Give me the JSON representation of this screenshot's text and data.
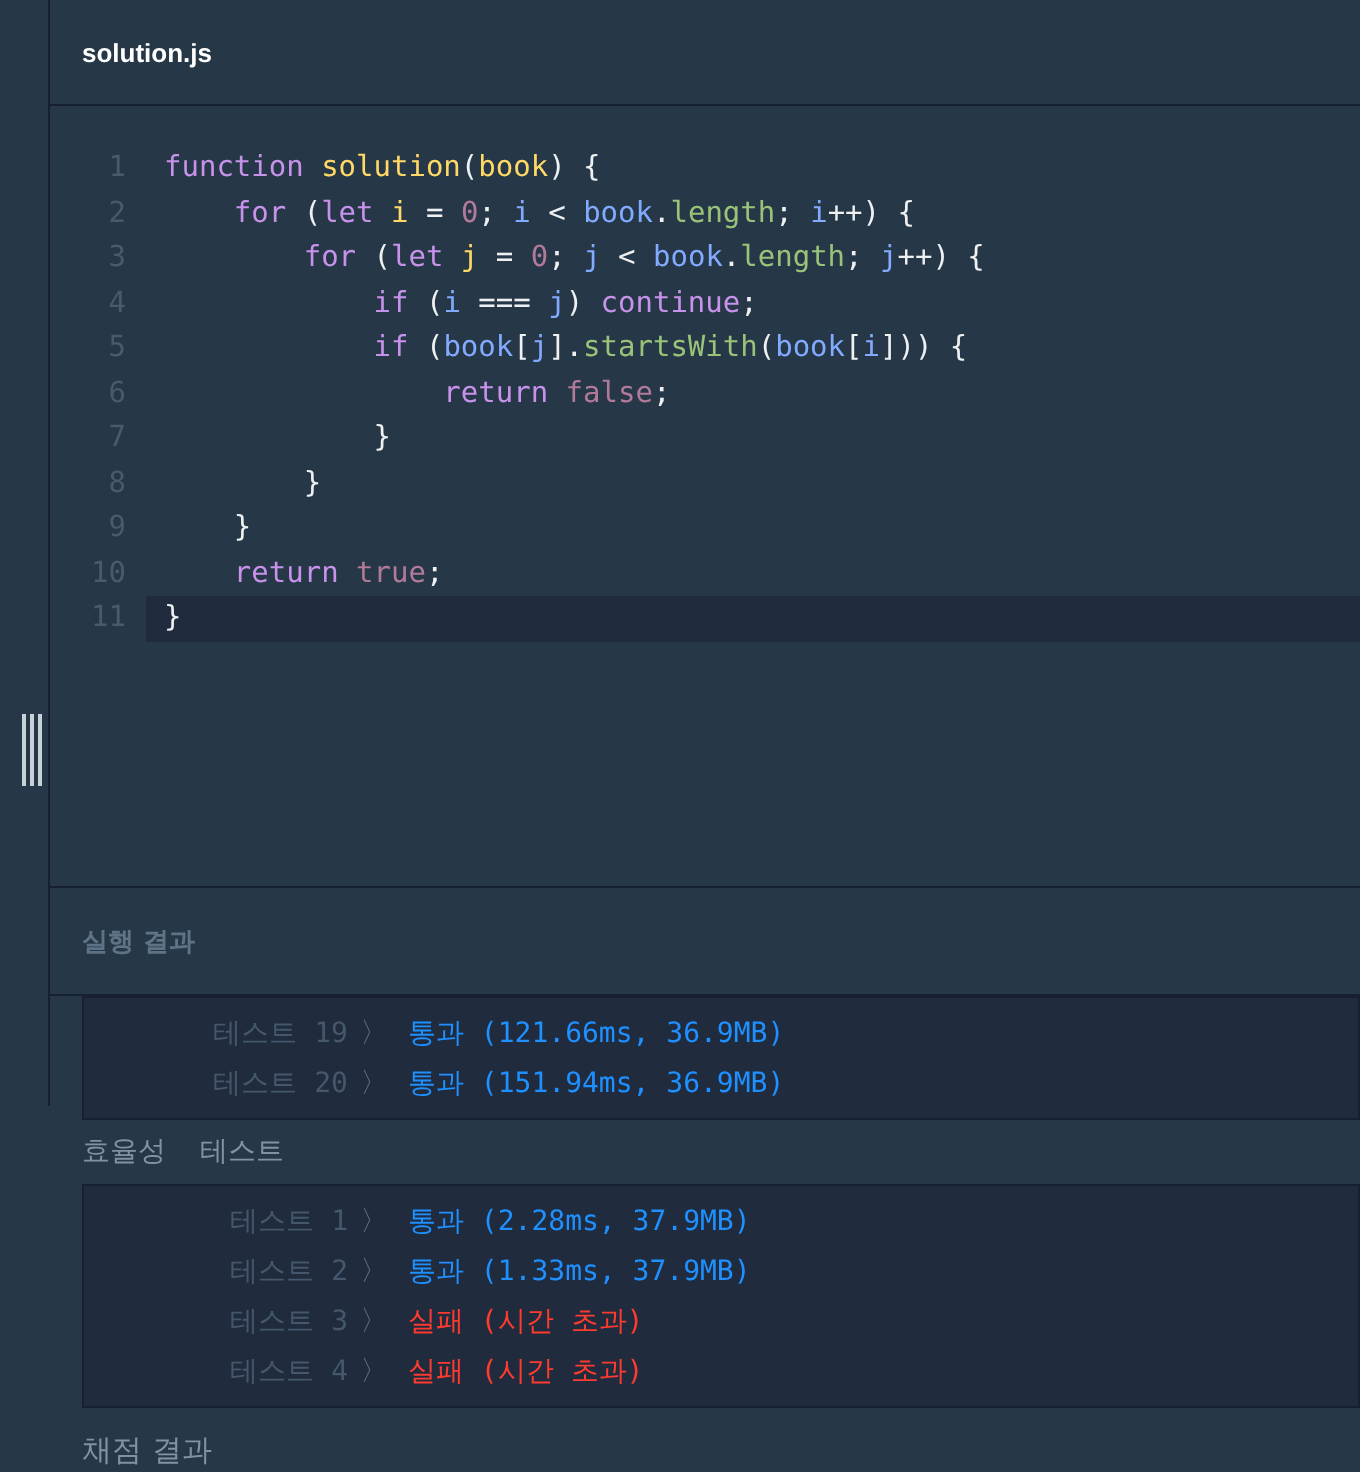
{
  "editor": {
    "filename": "solution.js",
    "lines": [
      {
        "number": "1",
        "active": false,
        "tokens": [
          {
            "t": "function ",
            "kind": "keyword"
          },
          {
            "t": "solution",
            "kind": "name"
          },
          {
            "t": "(",
            "kind": "plain"
          },
          {
            "t": "book",
            "kind": "name"
          },
          {
            "t": ") {",
            "kind": "plain"
          }
        ]
      },
      {
        "number": "2",
        "active": false,
        "tokens": [
          {
            "t": "    for",
            "kind": "keyword"
          },
          {
            "t": " (",
            "kind": "plain"
          },
          {
            "t": "let ",
            "kind": "keyword"
          },
          {
            "t": "i",
            "kind": "name"
          },
          {
            "t": " = ",
            "kind": "plain"
          },
          {
            "t": "0",
            "kind": "literal"
          },
          {
            "t": "; ",
            "kind": "plain"
          },
          {
            "t": "i",
            "kind": "variable"
          },
          {
            "t": " < ",
            "kind": "plain"
          },
          {
            "t": "book",
            "kind": "variable"
          },
          {
            "t": ".",
            "kind": "plain"
          },
          {
            "t": "length",
            "kind": "property"
          },
          {
            "t": "; ",
            "kind": "plain"
          },
          {
            "t": "i",
            "kind": "variable"
          },
          {
            "t": "++) {",
            "kind": "plain"
          }
        ]
      },
      {
        "number": "3",
        "active": false,
        "tokens": [
          {
            "t": "        for",
            "kind": "keyword"
          },
          {
            "t": " (",
            "kind": "plain"
          },
          {
            "t": "let ",
            "kind": "keyword"
          },
          {
            "t": "j",
            "kind": "name"
          },
          {
            "t": " = ",
            "kind": "plain"
          },
          {
            "t": "0",
            "kind": "literal"
          },
          {
            "t": "; ",
            "kind": "plain"
          },
          {
            "t": "j",
            "kind": "variable"
          },
          {
            "t": " < ",
            "kind": "plain"
          },
          {
            "t": "book",
            "kind": "variable"
          },
          {
            "t": ".",
            "kind": "plain"
          },
          {
            "t": "length",
            "kind": "property"
          },
          {
            "t": "; ",
            "kind": "plain"
          },
          {
            "t": "j",
            "kind": "variable"
          },
          {
            "t": "++) {",
            "kind": "plain"
          }
        ]
      },
      {
        "number": "4",
        "active": false,
        "tokens": [
          {
            "t": "            if",
            "kind": "keyword"
          },
          {
            "t": " (",
            "kind": "plain"
          },
          {
            "t": "i",
            "kind": "variable"
          },
          {
            "t": " === ",
            "kind": "plain"
          },
          {
            "t": "j",
            "kind": "variable"
          },
          {
            "t": ") ",
            "kind": "plain"
          },
          {
            "t": "continue",
            "kind": "keyword"
          },
          {
            "t": ";",
            "kind": "plain"
          }
        ]
      },
      {
        "number": "5",
        "active": false,
        "tokens": [
          {
            "t": "            if",
            "kind": "keyword"
          },
          {
            "t": " (",
            "kind": "plain"
          },
          {
            "t": "book",
            "kind": "variable"
          },
          {
            "t": "[",
            "kind": "plain"
          },
          {
            "t": "j",
            "kind": "variable"
          },
          {
            "t": "].",
            "kind": "plain"
          },
          {
            "t": "startsWith",
            "kind": "property"
          },
          {
            "t": "(",
            "kind": "plain"
          },
          {
            "t": "book",
            "kind": "variable"
          },
          {
            "t": "[",
            "kind": "plain"
          },
          {
            "t": "i",
            "kind": "variable"
          },
          {
            "t": "])) {",
            "kind": "plain"
          }
        ]
      },
      {
        "number": "6",
        "active": false,
        "tokens": [
          {
            "t": "                return ",
            "kind": "keyword"
          },
          {
            "t": "false",
            "kind": "literal"
          },
          {
            "t": ";",
            "kind": "plain"
          }
        ]
      },
      {
        "number": "7",
        "active": false,
        "tokens": [
          {
            "t": "            }",
            "kind": "plain"
          }
        ]
      },
      {
        "number": "8",
        "active": false,
        "tokens": [
          {
            "t": "        }",
            "kind": "plain"
          }
        ]
      },
      {
        "number": "9",
        "active": false,
        "tokens": [
          {
            "t": "    }",
            "kind": "plain"
          }
        ]
      },
      {
        "number": "10",
        "active": false,
        "tokens": [
          {
            "t": "    return ",
            "kind": "keyword"
          },
          {
            "t": "true",
            "kind": "literal"
          },
          {
            "t": ";",
            "kind": "plain"
          }
        ]
      },
      {
        "number": "11",
        "active": true,
        "tokens": [
          {
            "t": "}",
            "kind": "plain"
          }
        ]
      }
    ]
  },
  "results": {
    "title": "실행 결과",
    "groups": [
      {
        "rows": [
          {
            "label": "테스트 19",
            "chevron": "〉",
            "kind": "pass",
            "text": "통과 (121.66ms, 36.9MB)"
          },
          {
            "label": "테스트 20",
            "chevron": "〉",
            "kind": "pass",
            "text": "통과 (151.94ms, 36.9MB)"
          }
        ]
      },
      {
        "title": "효율성  테스트",
        "rows": [
          {
            "label": "테스트 1",
            "chevron": "〉",
            "kind": "pass",
            "text": "통과 (2.28ms, 37.9MB)"
          },
          {
            "label": "테스트 2",
            "chevron": "〉",
            "kind": "pass",
            "text": "통과 (1.33ms, 37.9MB)"
          },
          {
            "label": "테스트 3",
            "chevron": "〉",
            "kind": "fail",
            "text": "실패 (시간 초과)"
          },
          {
            "label": "테스트 4",
            "chevron": "〉",
            "kind": "fail",
            "text": "실패 (시간 초과)"
          }
        ]
      }
    ],
    "footer": "채점 결과"
  }
}
